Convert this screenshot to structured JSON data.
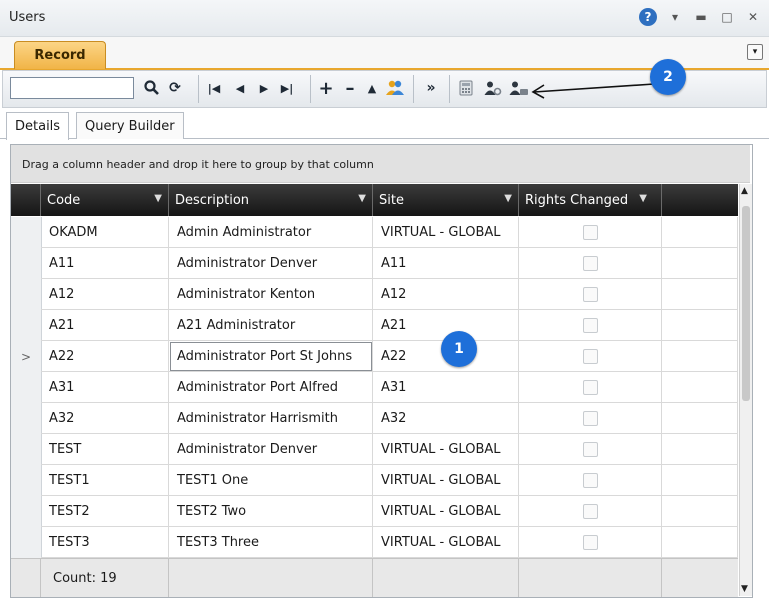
{
  "window": {
    "title": "Users"
  },
  "tabs": {
    "record": "Record"
  },
  "toolbar": {
    "search_value": ""
  },
  "subtabs": [
    {
      "label": "Details"
    },
    {
      "label": "Query Builder"
    }
  ],
  "grid": {
    "group_hint": "Drag a column header and drop it here to group by that column",
    "columns": [
      "Code",
      "Description",
      "Site",
      "Rights Changed"
    ],
    "rows": [
      {
        "code": "OKADM",
        "description": "Admin Administrator",
        "site": "VIRTUAL - GLOBAL",
        "rights_changed": false
      },
      {
        "code": "A11",
        "description": "Administrator Denver",
        "site": "A11",
        "rights_changed": false
      },
      {
        "code": "A12",
        "description": "Administrator Kenton",
        "site": "A12",
        "rights_changed": false
      },
      {
        "code": "A21",
        "description": "A21 Administrator",
        "site": "A21",
        "rights_changed": false
      },
      {
        "code": "A22",
        "description": "Administrator Port St Johns",
        "site": "A22",
        "rights_changed": false,
        "selected": true
      },
      {
        "code": "A31",
        "description": "Administrator Port Alfred",
        "site": "A31",
        "rights_changed": false
      },
      {
        "code": "A32",
        "description": "Administrator Harrismith",
        "site": "A32",
        "rights_changed": false
      },
      {
        "code": "TEST",
        "description": "Administrator Denver",
        "site": "VIRTUAL - GLOBAL",
        "rights_changed": false
      },
      {
        "code": "TEST1",
        "description": "TEST1 One",
        "site": "VIRTUAL - GLOBAL",
        "rights_changed": false
      },
      {
        "code": "TEST2",
        "description": "TEST2 Two",
        "site": "VIRTUAL - GLOBAL",
        "rights_changed": false
      },
      {
        "code": "TEST3",
        "description": "TEST3 Three",
        "site": "VIRTUAL - GLOBAL",
        "rights_changed": false
      }
    ],
    "selected_indicator": ">",
    "footer_count": "Count: 19"
  },
  "callouts": {
    "one": "1",
    "two": "2"
  },
  "colors": {
    "accent": "#f1b447",
    "callout": "#1e6fd9",
    "header_bg": "#151515"
  }
}
